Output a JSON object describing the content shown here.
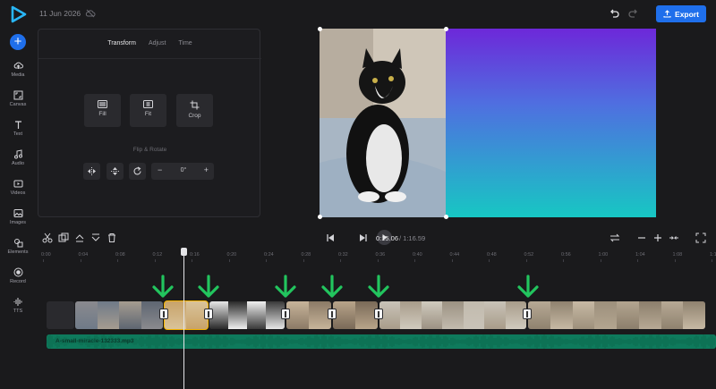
{
  "topbar": {
    "date": "11 Jun 2026",
    "export_label": "Export",
    "accent": "#1f6feb"
  },
  "rail": {
    "items": [
      {
        "label": "Media",
        "icon": "cloud-upload-icon"
      },
      {
        "label": "Canvas",
        "icon": "canvas-icon"
      },
      {
        "label": "Text",
        "icon": "text-icon"
      },
      {
        "label": "Audio",
        "icon": "music-note-icon"
      },
      {
        "label": "Videos",
        "icon": "video-icon"
      },
      {
        "label": "Images",
        "icon": "image-icon"
      },
      {
        "label": "Elements",
        "icon": "shapes-icon"
      },
      {
        "label": "Record",
        "icon": "record-icon"
      },
      {
        "label": "TTS",
        "icon": "waveform-icon"
      }
    ]
  },
  "panel": {
    "tabs": [
      "Transform",
      "Adjust",
      "Time"
    ],
    "active_tab": "Transform",
    "fit_options": [
      "Fill",
      "Fit",
      "Crop"
    ],
    "flip_rotate_label": "Flip & Rotate",
    "rotation_value": "0°",
    "minus": "−",
    "plus": "+"
  },
  "timeline": {
    "current_time": "0:15.06",
    "total_time": "/ 1:16.59",
    "ruler_ticks": [
      "0:00",
      "0:04",
      "0:08",
      "0:12",
      "0:16",
      "0:20",
      "0:24",
      "0:28",
      "0:32",
      "0:36",
      "0:40",
      "0:44",
      "0:48",
      "0:52",
      "0:56",
      "1:00",
      "1:04",
      "1:08",
      "1:12"
    ],
    "audio_track_name": "A-small-miracle-132333.mp3",
    "audio_color": "#0e7a5c",
    "marker_color": "#22c55e",
    "selected_clip_color": "#f5b400"
  }
}
